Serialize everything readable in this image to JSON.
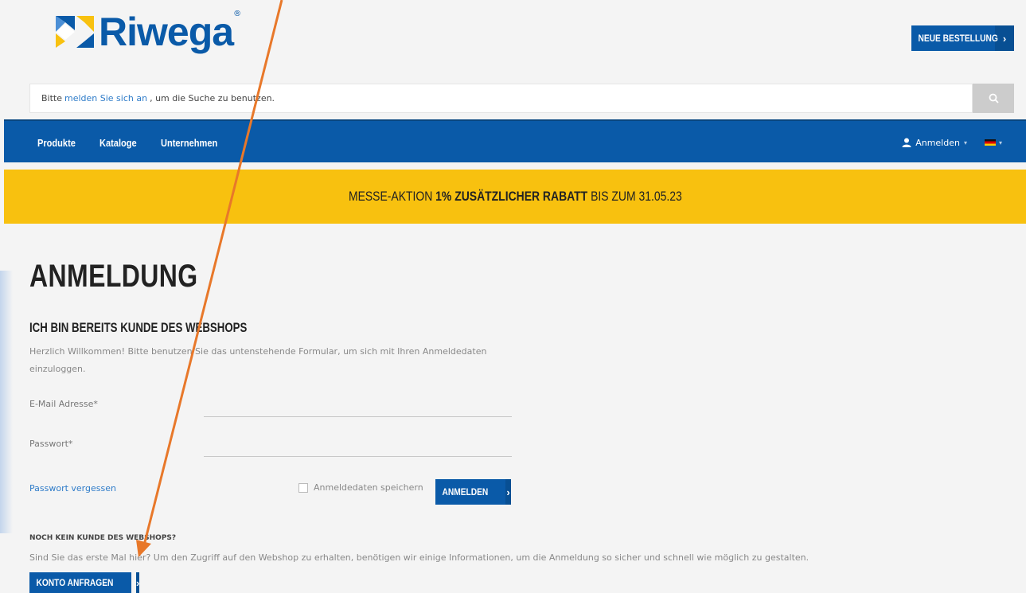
{
  "header": {
    "brand": "Riwega",
    "brand_mark": "®",
    "new_order_label": "NEUE BESTELLUNG",
    "new_order_arrow": "›"
  },
  "search": {
    "prefix": "Bitte",
    "link": "melden Sie sich an",
    "suffix": ", um die Suche zu benutzen.",
    "icon": "search-icon"
  },
  "nav": {
    "items": [
      {
        "label": "Produkte"
      },
      {
        "label": "Kataloge"
      },
      {
        "label": "Unternehmen"
      }
    ],
    "login_label": "Anmelden",
    "caret": "▾",
    "language": "de"
  },
  "promo": {
    "prefix": "MESSE-AKTION ",
    "bold": "1% ZUSÄTZLICHER RABATT",
    "suffix": " BIS ZUM 31.05.23"
  },
  "main": {
    "page_title": "ANMELDUNG",
    "section_title": "ICH BIN BEREITS KUNDE DES WEBSHOPS",
    "intro_text": "Herzlich Willkommen! Bitte benutzen Sie das untenstehende Formular, um sich mit Ihren Anmeldedaten einzuloggen.",
    "email_label": "E-Mail Adresse*",
    "email_value": "",
    "password_label": "Passwort*",
    "password_value": "",
    "forgot_link": "Passwort vergessen",
    "remember_label": "Anmeldedaten speichern",
    "login_button": "ANMELDEN",
    "arrow": "›"
  },
  "register": {
    "title": "NOCH KEIN KUNDE DES WEBSHOPS?",
    "text": "Sind Sie das erste Mal hier? Um den Zugriff auf den Webshop zu erhalten, benötigen wir einige Informationen, um die Anmeldung so sicher und schnell wie möglich zu gestalten.",
    "button": "KONTO ANFRAGEN",
    "arrow": "›"
  },
  "colors": {
    "brand_blue": "#0a5aa8",
    "promo_yellow": "#f8c10f",
    "annotation_orange": "#e8782a",
    "link_blue": "#2f7cc9"
  }
}
